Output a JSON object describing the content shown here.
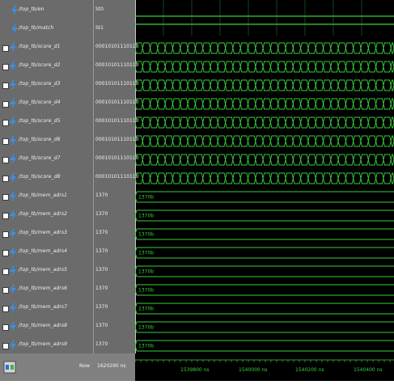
{
  "signals": [
    {
      "name": "/top_tb/en",
      "value": "St0",
      "kind": "bit",
      "icon": "lightning-icon"
    },
    {
      "name": "/top_tb/match",
      "value": "St1",
      "kind": "bit",
      "icon": "lightning-icon"
    },
    {
      "name": "/top_tb/score_d1",
      "value": "00010101110110",
      "kind": "bus",
      "icon": "lightning-icon"
    },
    {
      "name": "/top_tb/score_d2",
      "value": "00010101110110",
      "kind": "bus",
      "icon": "lightning-icon"
    },
    {
      "name": "/top_tb/score_d3",
      "value": "00010101110110",
      "kind": "bus",
      "icon": "lightning-icon"
    },
    {
      "name": "/top_tb/score_d4",
      "value": "00010101110110",
      "kind": "bus",
      "icon": "lightning-icon"
    },
    {
      "name": "/top_tb/score_d5",
      "value": "00010101110110",
      "kind": "bus",
      "icon": "lightning-icon"
    },
    {
      "name": "/top_tb/score_d6",
      "value": "00010101110110",
      "kind": "bus",
      "icon": "lightning-icon"
    },
    {
      "name": "/top_tb/score_d7",
      "value": "00010101110110",
      "kind": "bus",
      "icon": "lightning-icon"
    },
    {
      "name": "/top_tb/score_d8",
      "value": "00010101110110",
      "kind": "bus",
      "icon": "lightning-icon"
    },
    {
      "name": "/top_tb/mem_adrs1",
      "value": "1370",
      "kind": "addr",
      "wave_label": "1370b",
      "icon": "lightning-icon"
    },
    {
      "name": "/top_tb/mem_adrs2",
      "value": "1370",
      "kind": "addr",
      "wave_label": "1370b",
      "icon": "lightning-icon"
    },
    {
      "name": "/top_tb/mem_adrs3",
      "value": "1370",
      "kind": "addr",
      "wave_label": "1370b",
      "icon": "lightning-icon"
    },
    {
      "name": "/top_tb/mem_adrs4",
      "value": "1370",
      "kind": "addr",
      "wave_label": "1370b",
      "icon": "lightning-icon"
    },
    {
      "name": "/top_tb/mem_adrs5",
      "value": "1370",
      "kind": "addr",
      "wave_label": "1370b",
      "icon": "lightning-icon"
    },
    {
      "name": "/top_tb/mem_adrs6",
      "value": "1370",
      "kind": "addr",
      "wave_label": "1370b",
      "icon": "lightning-icon"
    },
    {
      "name": "/top_tb/mem_adrs7",
      "value": "1370",
      "kind": "addr",
      "wave_label": "1370b",
      "icon": "lightning-icon"
    },
    {
      "name": "/top_tb/mem_adrs8",
      "value": "1370",
      "kind": "addr",
      "wave_label": "1370b",
      "icon": "lightning-icon"
    },
    {
      "name": "/top_tb/mem_adrs9",
      "value": "1370",
      "kind": "addr",
      "wave_label": "1370b",
      "icon": "lightning-icon"
    }
  ],
  "footer": {
    "now_label": "Now",
    "now_value": "1620290 ns",
    "time_ticks": [
      "1539800 ns",
      "1540000 ns",
      "1540200 ns",
      "1540400 ns"
    ]
  },
  "colors": {
    "wave": "#39d13a",
    "background": "#000000",
    "pane": "#6b6b6b"
  }
}
